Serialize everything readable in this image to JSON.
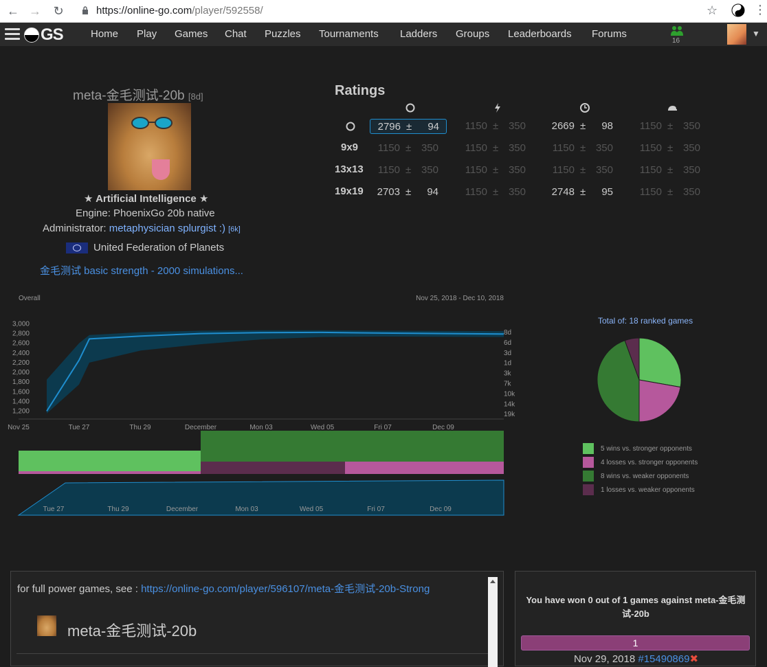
{
  "browser": {
    "url_host": "https://online-go.com",
    "url_path": "/player/592558/"
  },
  "nav": {
    "logo": "GS",
    "links": [
      "Home",
      "Play",
      "Games",
      "Chat",
      "Puzzles",
      "Tournaments",
      "Ladders",
      "Groups",
      "Leaderboards",
      "Forums"
    ],
    "friends_count": "16"
  },
  "profile": {
    "name": "meta-金毛测试-20b",
    "rank": "[8d]",
    "ai_label": "Artificial Intelligence",
    "engine": "Engine: PhoenixGo 20b native",
    "admin_prefix": "Administrator:",
    "admin_name": "metaphysician splurgist :)",
    "admin_rank": "[6k]",
    "country": "United Federation of Planets",
    "about_link": "金毛测试 basic strength - 2000 simulations..."
  },
  "ratings": {
    "title": "Ratings",
    "columns": [
      "overall-icon",
      "blitz-icon",
      "live-icon",
      "correspondence-icon"
    ],
    "rows": [
      {
        "label": "",
        "icon": "overall-icon",
        "cells": [
          {
            "r": "2796",
            "pm": "±",
            "d": "94",
            "state": "selected"
          },
          {
            "r": "1150",
            "pm": "±",
            "d": "350",
            "state": "dim"
          },
          {
            "r": "2669",
            "pm": "±",
            "d": "98",
            "state": "active"
          },
          {
            "r": "1150",
            "pm": "±",
            "d": "350",
            "state": "dim"
          }
        ]
      },
      {
        "label": "9x9",
        "cells": [
          {
            "r": "1150",
            "pm": "±",
            "d": "350",
            "state": "dim"
          },
          {
            "r": "1150",
            "pm": "±",
            "d": "350",
            "state": "dim"
          },
          {
            "r": "1150",
            "pm": "±",
            "d": "350",
            "state": "dim"
          },
          {
            "r": "1150",
            "pm": "±",
            "d": "350",
            "state": "dim"
          }
        ]
      },
      {
        "label": "13x13",
        "cells": [
          {
            "r": "1150",
            "pm": "±",
            "d": "350",
            "state": "dim"
          },
          {
            "r": "1150",
            "pm": "±",
            "d": "350",
            "state": "dim"
          },
          {
            "r": "1150",
            "pm": "±",
            "d": "350",
            "state": "dim"
          },
          {
            "r": "1150",
            "pm": "±",
            "d": "350",
            "state": "dim"
          }
        ]
      },
      {
        "label": "19x19",
        "cells": [
          {
            "r": "2703",
            "pm": "±",
            "d": "94",
            "state": "active"
          },
          {
            "r": "1150",
            "pm": "±",
            "d": "350",
            "state": "dim"
          },
          {
            "r": "2748",
            "pm": "±",
            "d": "95",
            "state": "active"
          },
          {
            "r": "1150",
            "pm": "±",
            "d": "350",
            "state": "dim"
          }
        ]
      }
    ]
  },
  "chart_data": [
    {
      "type": "area",
      "title": "Overall",
      "subtitle": "Nov 25, 2018 - Dec 10, 2018",
      "x": [
        "Nov 25",
        "Tue 27",
        "Thu 29",
        "December",
        "Mon 03",
        "Wed 05",
        "Fri 07",
        "Dec 09"
      ],
      "y_ticks": [
        "3,000",
        "2,800",
        "2,600",
        "2,400",
        "2,200",
        "2,000",
        "1,800",
        "1,600",
        "1,400",
        "1,200"
      ],
      "rank_ticks": [
        "8d",
        "6d",
        "3d",
        "1d",
        "3k",
        "7k",
        "10k",
        "14k",
        "19k"
      ],
      "ylim": [
        1150,
        3050
      ],
      "series": [
        {
          "values": [
            1200,
            2250,
            2690,
            2750,
            2800,
            2820,
            2825,
            2810,
            2790
          ]
        }
      ],
      "x_positions_label": [
        "Nov 26",
        "Nov 27",
        "Nov 27.5",
        "Nov 29",
        "Dec 01",
        "Dec 03",
        "Dec 05",
        "Dec 07",
        "Dec 10"
      ],
      "band_upper": [
        1850,
        2600,
        2770,
        2830,
        2860,
        2870,
        2870,
        2860,
        2850
      ],
      "band_lower": [
        1100,
        1750,
        2200,
        2450,
        2580,
        2680,
        2730,
        2740,
        2730
      ]
    },
    {
      "type": "pie",
      "title": "Total of: 18 ranked games",
      "slices": [
        {
          "label": "5 wins vs. stronger opponents",
          "value": 5,
          "color": "#5fc15f"
        },
        {
          "label": "4 losses vs. stronger opponents",
          "value": 4,
          "color": "#b6589c"
        },
        {
          "label": "8 wins vs. weaker opponents",
          "value": 8,
          "color": "#357a33"
        },
        {
          "label": "1 losses vs. weaker opponents",
          "value": 1,
          "color": "#5b2d4d"
        }
      ]
    }
  ],
  "timeline_labels": [
    "Tue 27",
    "Thu 29",
    "December",
    "Mon 03",
    "Wed 05",
    "Fri 07",
    "Dec 09"
  ],
  "about": {
    "fullpower_prefix": "for full power games, see :",
    "fullpower_link": "https://online-go.com/player/596107/meta-金毛测试-20b-Strong",
    "name": "meta-金毛测试-20b"
  },
  "vs": {
    "text": "You have won 0 out of 1 games against meta-金毛测试-20b",
    "bar_count": "1",
    "game_date": "Nov 29, 2018",
    "game_link": "#15490869",
    "result_icon": "✖"
  },
  "colors": {
    "accent": "#4a90e2",
    "chart_band": "#0c3a4e",
    "chart_line": "#1f8ecf"
  }
}
